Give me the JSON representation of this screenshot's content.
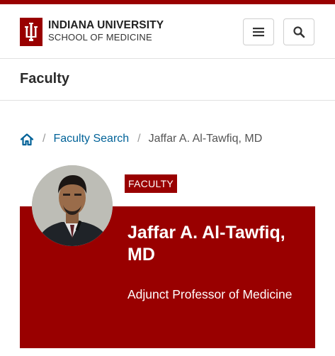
{
  "brand": {
    "line1": "INDIANA UNIVERSITY",
    "line2": "SCHOOL OF MEDICINE",
    "color": "#990000"
  },
  "header": {
    "menu_icon": "hamburger-menu-icon",
    "search_icon": "search-icon"
  },
  "section": {
    "title": "Faculty"
  },
  "breadcrumb": {
    "home_icon": "home-icon",
    "separator": "/",
    "items": [
      {
        "label": "Faculty Search"
      },
      {
        "label": "Jaffar A. Al-Tawfiq, MD"
      }
    ]
  },
  "profile": {
    "badge": "FACULTY",
    "name": "Jaffar A. Al-Tawfiq, MD",
    "title": "Adjunct Professor of Medicine",
    "panel_color": "#990000"
  }
}
